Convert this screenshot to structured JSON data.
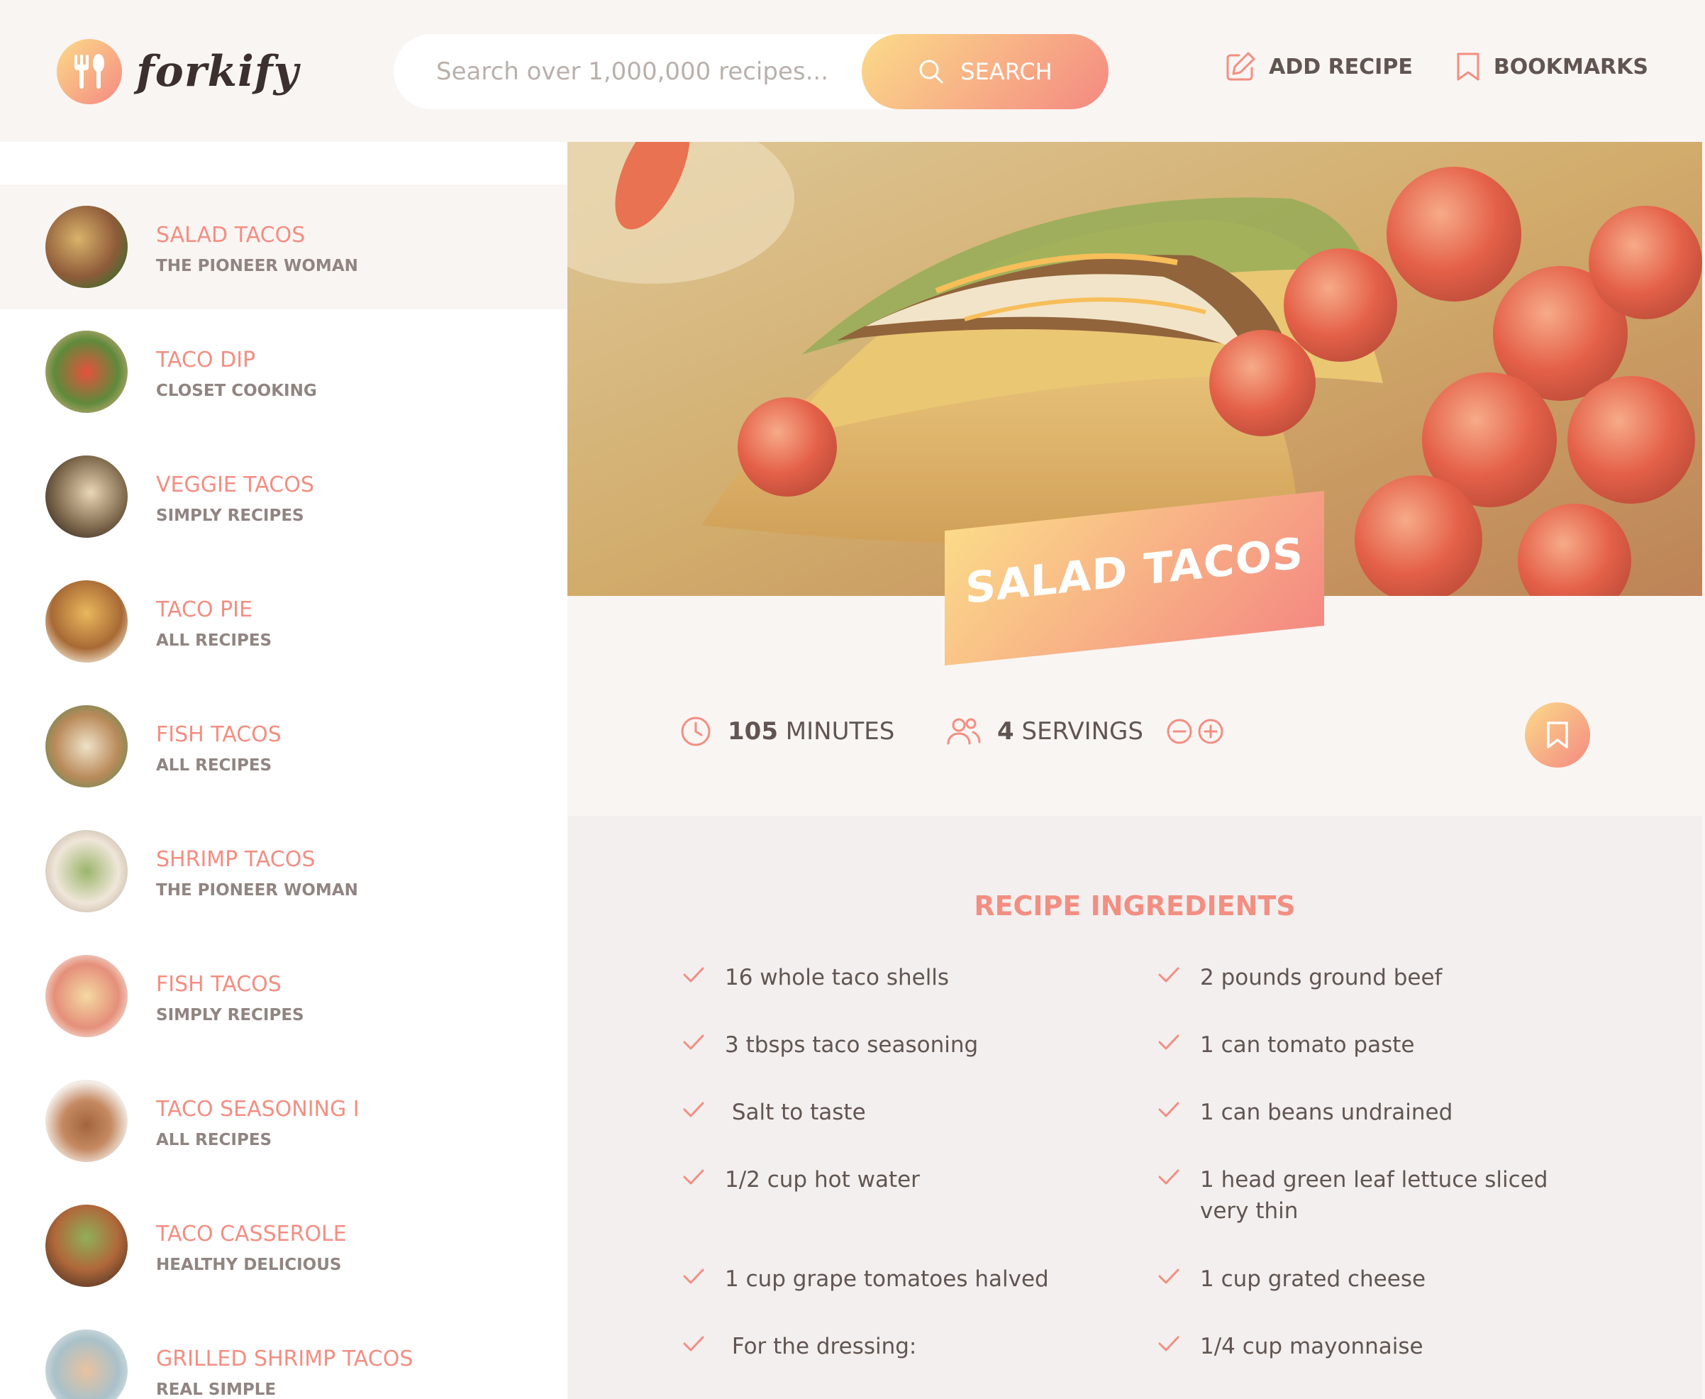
{
  "app": {
    "name": "forkify"
  },
  "search": {
    "placeholder": "Search over 1,000,000 recipes...",
    "button_label": "SEARCH"
  },
  "nav": {
    "add_recipe": "ADD RECIPE",
    "bookmarks": "BOOKMARKS"
  },
  "results": [
    {
      "title": "SALAD TACOS",
      "publisher": "THE PIONEER WOMAN",
      "active": true
    },
    {
      "title": "TACO DIP",
      "publisher": "CLOSET COOKING"
    },
    {
      "title": "VEGGIE TACOS",
      "publisher": "SIMPLY RECIPES"
    },
    {
      "title": "TACO PIE",
      "publisher": "ALL RECIPES"
    },
    {
      "title": "FISH TACOS",
      "publisher": "ALL RECIPES"
    },
    {
      "title": "SHRIMP TACOS",
      "publisher": "THE PIONEER WOMAN"
    },
    {
      "title": "FISH TACOS",
      "publisher": "SIMPLY RECIPES"
    },
    {
      "title": "TACO SEASONING I",
      "publisher": "ALL RECIPES"
    },
    {
      "title": "TACO CASSEROLE",
      "publisher": "HEALTHY DELICIOUS"
    },
    {
      "title": "GRILLED SHRIMP TACOS",
      "publisher": "REAL SIMPLE"
    }
  ],
  "recipe": {
    "title": "SALAD TACOS",
    "cooking_time_value": "105",
    "cooking_time_unit": "MINUTES",
    "servings_value": "4",
    "servings_unit": "SERVINGS",
    "ingredients_heading": "RECIPE INGREDIENTS",
    "ingredients": [
      "16 whole taco shells",
      "2 pounds ground beef",
      "3 tbsps taco seasoning",
      "1 can tomato paste",
      " Salt to taste",
      "1 can beans undrained",
      "1/2 cup hot water",
      "1 head green leaf lettuce sliced very thin",
      "1 cup grape tomatoes halved",
      "1 cup grated cheese",
      " For the dressing:",
      "1/4 cup mayonnaise"
    ]
  },
  "colors": {
    "accent": "#f38e82",
    "gradient_start": "#fbdb89",
    "gradient_end": "#f48982",
    "background": "#f9f5f3",
    "ingredients_bg": "#f2efee"
  },
  "icons": {
    "logo": "fork-knife-icon",
    "search": "search-icon",
    "add_recipe": "edit-icon",
    "bookmarks": "bookmark-icon",
    "time": "clock-icon",
    "servings": "users-icon",
    "decrease": "minus-circle-icon",
    "increase": "plus-circle-icon",
    "ingredient_check": "check-icon"
  }
}
